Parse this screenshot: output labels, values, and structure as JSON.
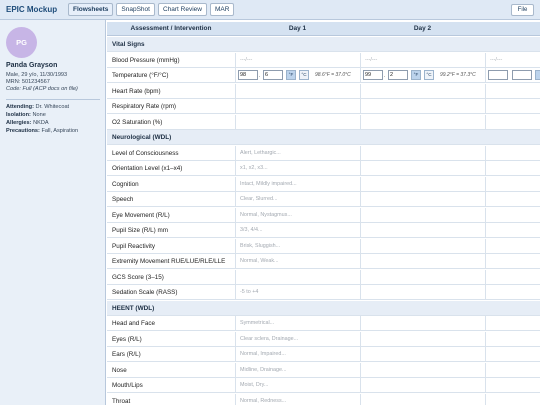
{
  "app": {
    "title": "EPIC Mockup",
    "file_label": "File"
  },
  "tabs": [
    {
      "label": "Flowsheets",
      "active": true
    },
    {
      "label": "SnapShot",
      "active": false
    },
    {
      "label": "Chart Review",
      "active": false
    },
    {
      "label": "MAR",
      "active": false
    }
  ],
  "patient": {
    "initials": "PG",
    "avatar_color": "#c7b5e6",
    "name": "Panda Grayson",
    "demographics": "Male, 29 y/o, 11/30/1993",
    "mrn": "MRN: 501234567",
    "code": "Code: Full (ACP docs on file)",
    "attending_label": "Attending:",
    "attending": "Dr. Whitecoat",
    "isolation_label": "Isolation:",
    "isolation": "None",
    "allergies_label": "Allergies:",
    "allergies": "NKDA",
    "precautions_label": "Precautions:",
    "precautions": "Fall, Aspiration"
  },
  "grid": {
    "header": {
      "col0": "Assessment / Intervention",
      "day1": "Day 1",
      "day2": "Day 2"
    },
    "rows": [
      {
        "type": "section",
        "label": "Vital Signs"
      },
      {
        "type": "row",
        "label": "Blood Pressure (mmHg)",
        "d1": "---/---",
        "d2": "---/---",
        "d3": "---/---"
      },
      {
        "type": "temp",
        "label": "Temperature (°F/°C)"
      },
      {
        "type": "row",
        "label": "Heart Rate (bpm)",
        "d1": "",
        "d2": ""
      },
      {
        "type": "row",
        "label": "Respiratory Rate (rpm)",
        "d1": "",
        "d2": ""
      },
      {
        "type": "row",
        "label": "O2 Saturation (%)",
        "d1": "",
        "d2": ""
      },
      {
        "type": "section",
        "label": "Neurological (WDL)"
      },
      {
        "type": "row",
        "label": "Level of Consciousness",
        "d1": "Alert, Lethargic...",
        "d2": ""
      },
      {
        "type": "row",
        "label": "Orientation Level (x1–x4)",
        "d1": "x1, x2, x3...",
        "d2": ""
      },
      {
        "type": "row",
        "label": "Cognition",
        "d1": "Intact, Mildly impaired...",
        "d2": ""
      },
      {
        "type": "row",
        "label": "Speech",
        "d1": "Clear, Slurred...",
        "d2": ""
      },
      {
        "type": "row",
        "label": "Eye Movement (R/L)",
        "d1": "Normal, Nystagmus...",
        "d2": ""
      },
      {
        "type": "row",
        "label": "Pupil Size (R/L) mm",
        "d1": "3/3, 4/4...",
        "d2": ""
      },
      {
        "type": "row",
        "label": "Pupil Reactivity",
        "d1": "Brisk, Sluggish...",
        "d2": ""
      },
      {
        "type": "row",
        "label": "Extremity Movement RUE/LUE/RLE/LLE",
        "d1": "Normal, Weak...",
        "d2": ""
      },
      {
        "type": "row",
        "label": "GCS Score (3–15)",
        "d1": "",
        "d2": ""
      },
      {
        "type": "row",
        "label": "Sedation Scale (RASS)",
        "d1": "-5 to +4",
        "d2": ""
      },
      {
        "type": "section",
        "label": "HEENT (WDL)"
      },
      {
        "type": "row",
        "label": "Head and Face",
        "d1": "Symmetrical...",
        "d2": ""
      },
      {
        "type": "row",
        "label": "Eyes (R/L)",
        "d1": "Clear sclera, Drainage...",
        "d2": ""
      },
      {
        "type": "row",
        "label": "Ears (R/L)",
        "d1": "Normal, Impaired...",
        "d2": ""
      },
      {
        "type": "row",
        "label": "Nose",
        "d1": "Midline, Drainage...",
        "d2": ""
      },
      {
        "type": "row",
        "label": "Mouth/Lips",
        "d1": "Moist, Dry...",
        "d2": ""
      },
      {
        "type": "row",
        "label": "Throat",
        "d1": "Normal, Redness...",
        "d2": ""
      }
    ],
    "temperature": {
      "day1": {
        "whole": "98",
        "decimal": "6",
        "unit_f": "°F",
        "unit_c": "°C",
        "converted": "98.6°F = 37.0°C"
      },
      "day2": {
        "whole": "99",
        "decimal": "2",
        "unit_f": "°F",
        "unit_c": "°C",
        "converted": "99.2°F = 37.3°C"
      }
    }
  }
}
